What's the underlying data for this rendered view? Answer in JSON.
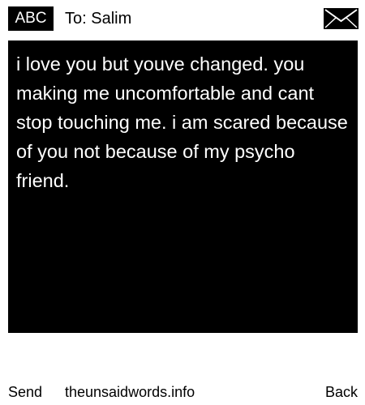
{
  "header": {
    "mode_label": "ABC",
    "recipient": "To: Salim",
    "icon": "envelope-icon"
  },
  "message": {
    "text": "i love you but youve changed. you making me uncomfortable and cant stop touching me. i am scared because of you not because of my psycho friend."
  },
  "footer": {
    "send_label": "Send",
    "site_label": "theunsaidwords.info",
    "back_label": "Back"
  },
  "colors": {
    "background": "#ffffff",
    "message_background": "#000000",
    "message_text": "#ffffff",
    "text": "#000000"
  }
}
